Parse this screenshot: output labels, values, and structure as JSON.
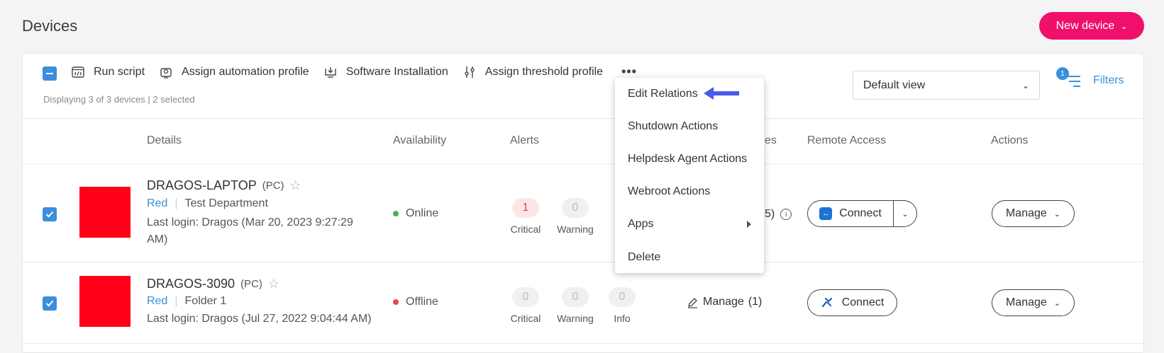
{
  "page": {
    "title": "Devices",
    "new_device_label": "New device"
  },
  "toolbar": {
    "run_script": "Run script",
    "assign_automation": "Assign automation profile",
    "software_installation": "Software Installation",
    "assign_threshold": "Assign threshold profile",
    "more": "•••",
    "displaying": "Displaying 3 of 3 devices | 2 selected",
    "view_select": "Default view",
    "filters_label": "Filters",
    "filters_count": "1"
  },
  "columns": {
    "details": "Details",
    "availability": "Availability",
    "alerts": "Alerts",
    "partial": "es",
    "remote_access": "Remote Access",
    "actions": "Actions"
  },
  "rows": [
    {
      "name": "DRAGOS-LAPTOP",
      "type": "(PC)",
      "group": "Red",
      "folder": "Test Department",
      "last_login": "Last login: Dragos (Mar 20, 2023 9:27:29 AM)",
      "availability": "Online",
      "availability_color": "#4caf50",
      "critical": "1",
      "warning": "0",
      "critical_label": "Critical",
      "warning_label": "Warning",
      "partial_count": "5)",
      "connect_label": "Connect",
      "manage_label": "Manage"
    },
    {
      "name": "DRAGOS-3090",
      "type": "(PC)",
      "group": "Red",
      "folder": "Folder 1",
      "last_login": "Last login: Dragos (Jul 27, 2022 9:04:44 AM)",
      "availability": "Offline",
      "availability_color": "#e5484d",
      "critical": "0",
      "warning": "0",
      "info": "0",
      "critical_label": "Critical",
      "warning_label": "Warning",
      "info_label": "Info",
      "manage_link": "Manage",
      "manage_link_count": "(1)",
      "connect_label": "Connect",
      "manage_label": "Manage"
    }
  ],
  "menu": {
    "items": [
      "Edit Relations",
      "Shutdown Actions",
      "Helpdesk Agent Actions",
      "Webroot Actions",
      "Apps",
      "Delete"
    ]
  },
  "colors": {
    "accent": "#3a8ede",
    "brand": "#f0106b",
    "pointer": "#4a5ae8"
  }
}
